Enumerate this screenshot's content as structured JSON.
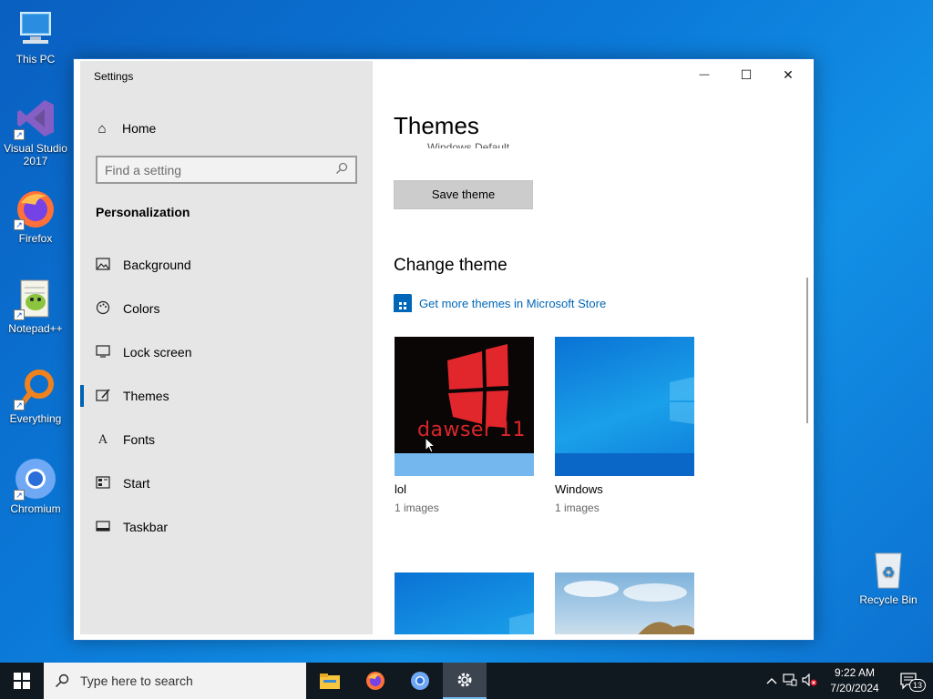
{
  "desktop": {
    "icons": [
      {
        "label": "This PC"
      },
      {
        "label": "Visual Studio 2017"
      },
      {
        "label": "Firefox"
      },
      {
        "label": "Notepad++"
      },
      {
        "label": "Everything"
      },
      {
        "label": "Chromium"
      },
      {
        "label": "Recycle Bin"
      }
    ]
  },
  "window": {
    "app_title": "Settings",
    "controls": {
      "minimize": "—",
      "maximize": "☐",
      "close": "✕"
    }
  },
  "sidebar": {
    "home_label": "Home",
    "search_placeholder": "Find a setting",
    "section_title": "Personalization",
    "items": [
      {
        "label": "Background",
        "icon": "image-icon"
      },
      {
        "label": "Colors",
        "icon": "palette-icon"
      },
      {
        "label": "Lock screen",
        "icon": "monitor-icon"
      },
      {
        "label": "Themes",
        "icon": "brush-icon",
        "active": true
      },
      {
        "label": "Fonts",
        "icon": "font-icon"
      },
      {
        "label": "Start",
        "icon": "start-menu-icon"
      },
      {
        "label": "Taskbar",
        "icon": "taskbar-icon"
      }
    ]
  },
  "main": {
    "title": "Themes",
    "clipped_text": "Windows Default",
    "save_button": "Save theme",
    "change_theme_title": "Change theme",
    "store_link": "Get more themes in Microsoft Store",
    "themes": [
      {
        "name": "lol",
        "count": "1 images",
        "overlay_text": "dawser 11"
      },
      {
        "name": "Windows",
        "count": "1 images"
      }
    ]
  },
  "taskbar": {
    "search_placeholder": "Type here to search",
    "clock_time": "9:22 AM",
    "clock_date": "7/20/2024",
    "notification_count": "13"
  },
  "colors": {
    "accent": "#0067b8",
    "sidebar_bg": "#e6e6e6",
    "taskbar_bg": "#101820"
  }
}
